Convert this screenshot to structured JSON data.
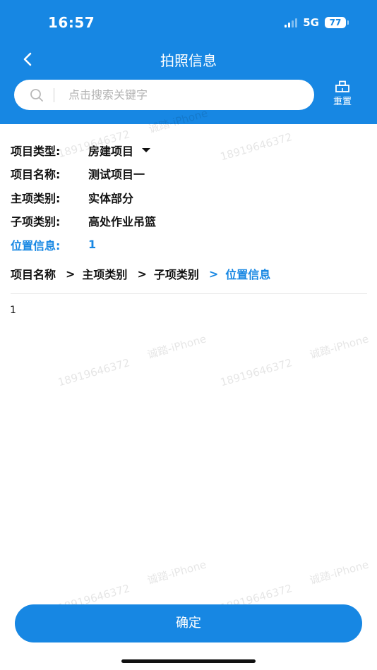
{
  "status_bar": {
    "time": "16:57",
    "network": "5G",
    "battery": "77"
  },
  "nav": {
    "title": "拍照信息"
  },
  "search": {
    "placeholder": "点击搜索关键字"
  },
  "reset": {
    "label": "重置"
  },
  "info": {
    "project_type_label": "项目类型:",
    "project_type_value": "房建项目",
    "project_name_label": "项目名称:",
    "project_name_value": "测试项目一",
    "main_category_label": "主项类别:",
    "main_category_value": "实体部分",
    "sub_category_label": "子项类别:",
    "sub_category_value": "高处作业吊篮",
    "location_label": "位置信息:",
    "location_value": "1"
  },
  "breadcrumb": {
    "items": [
      "项目名称",
      "主项类别",
      "子项类别",
      "位置信息"
    ],
    "separator": ">"
  },
  "list": {
    "items": [
      "1"
    ]
  },
  "watermark": {
    "phone": "18919646372",
    "user": "诚踏-iPhone"
  },
  "confirm": {
    "label": "确定"
  },
  "colors": {
    "primary": "#1787e3"
  }
}
